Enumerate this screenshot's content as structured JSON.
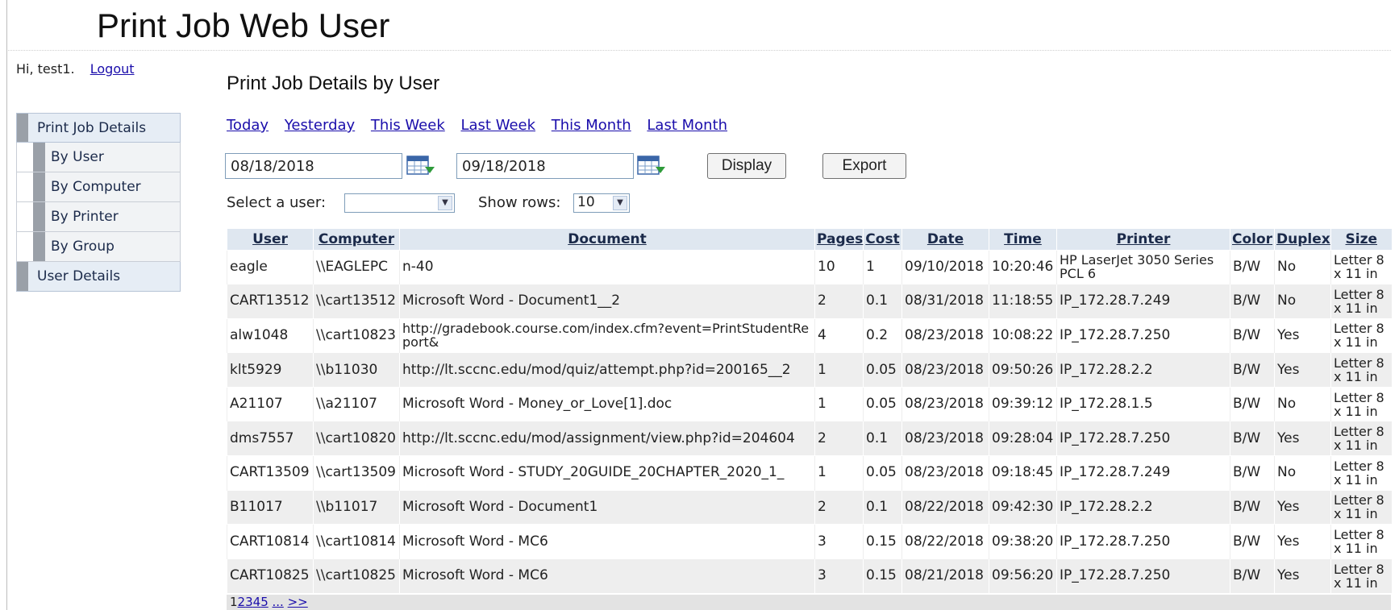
{
  "app": {
    "title": "Print Job Web User"
  },
  "session": {
    "greeting": "Hi, test1.",
    "logout_label": "Logout"
  },
  "nav": {
    "print_job_details": "Print Job Details",
    "by_user": "By User",
    "by_computer": "By Computer",
    "by_printer": "By Printer",
    "by_group": "By Group",
    "user_details": "User Details"
  },
  "page": {
    "title": "Print Job Details by User"
  },
  "quick_links": [
    "Today",
    "Yesterday",
    "This Week",
    "Last Week",
    "This Month",
    "Last Month"
  ],
  "dates": {
    "start": "08/18/2018",
    "end": "09/18/2018"
  },
  "actions": {
    "display": "Display",
    "export": "Export"
  },
  "filters": {
    "select_user_label": "Select a user:",
    "selected_user": "",
    "show_rows_label": "Show rows:",
    "show_rows_value": "10"
  },
  "table": {
    "headers": [
      "User",
      "Computer",
      "Document",
      "Pages",
      "Cost",
      "Date",
      "Time",
      "Printer",
      "Color",
      "Duplex",
      "Size"
    ],
    "rows": [
      [
        "eagle",
        "\\\\EAGLEPC",
        "n-40",
        "10",
        "1",
        "09/10/2018",
        "10:20:46",
        "HP LaserJet 3050 Series PCL 6",
        "B/W",
        "No",
        "Letter 8 x 11 in"
      ],
      [
        "CART13512",
        "\\\\cart13512",
        "Microsoft Word - Document1__2",
        "2",
        "0.1",
        "08/31/2018",
        "11:18:55",
        "IP_172.28.7.249",
        "B/W",
        "No",
        "Letter 8 x 11 in"
      ],
      [
        "alw1048",
        "\\\\cart10823",
        "http://gradebook.course.com/index.cfm?event=PrintStudentReport&",
        "4",
        "0.2",
        "08/23/2018",
        "10:08:22",
        "IP_172.28.7.250",
        "B/W",
        "Yes",
        "Letter 8 x 11 in"
      ],
      [
        "klt5929",
        "\\\\b11030",
        "http://lt.sccnc.edu/mod/quiz/attempt.php?id=200165__2",
        "1",
        "0.05",
        "08/23/2018",
        "09:50:26",
        "IP_172.28.2.2",
        "B/W",
        "Yes",
        "Letter 8 x 11 in"
      ],
      [
        "A21107",
        "\\\\a21107",
        "Microsoft Word - Money_or_Love[1].doc",
        "1",
        "0.05",
        "08/23/2018",
        "09:39:12",
        "IP_172.28.1.5",
        "B/W",
        "No",
        "Letter 8 x 11 in"
      ],
      [
        "dms7557",
        "\\\\cart10820",
        "http://lt.sccnc.edu/mod/assignment/view.php?id=204604",
        "2",
        "0.1",
        "08/23/2018",
        "09:28:04",
        "IP_172.28.7.250",
        "B/W",
        "Yes",
        "Letter 8 x 11 in"
      ],
      [
        "CART13509",
        "\\\\cart13509",
        "Microsoft Word - STUDY_20GUIDE_20CHAPTER_2020_1_",
        "1",
        "0.05",
        "08/23/2018",
        "09:18:45",
        "IP_172.28.7.249",
        "B/W",
        "No",
        "Letter 8 x 11 in"
      ],
      [
        "B11017",
        "\\\\b11017",
        "Microsoft Word - Document1",
        "2",
        "0.1",
        "08/22/2018",
        "09:42:30",
        "IP_172.28.2.2",
        "B/W",
        "Yes",
        "Letter 8 x 11 in"
      ],
      [
        "CART10814",
        "\\\\cart10814",
        "Microsoft Word - MC6",
        "3",
        "0.15",
        "08/22/2018",
        "09:38:20",
        "IP_172.28.7.250",
        "B/W",
        "Yes",
        "Letter 8 x 11 in"
      ],
      [
        "CART10825",
        "\\\\cart10825",
        "Microsoft Word - MC6",
        "3",
        "0.15",
        "08/21/2018",
        "09:56:20",
        "IP_172.28.7.250",
        "B/W",
        "Yes",
        "Letter 8 x 11 in"
      ]
    ]
  },
  "pager": {
    "current": "1",
    "pages": [
      "2",
      "3",
      "4",
      "5"
    ],
    "more": "...",
    "next": ">>"
  }
}
